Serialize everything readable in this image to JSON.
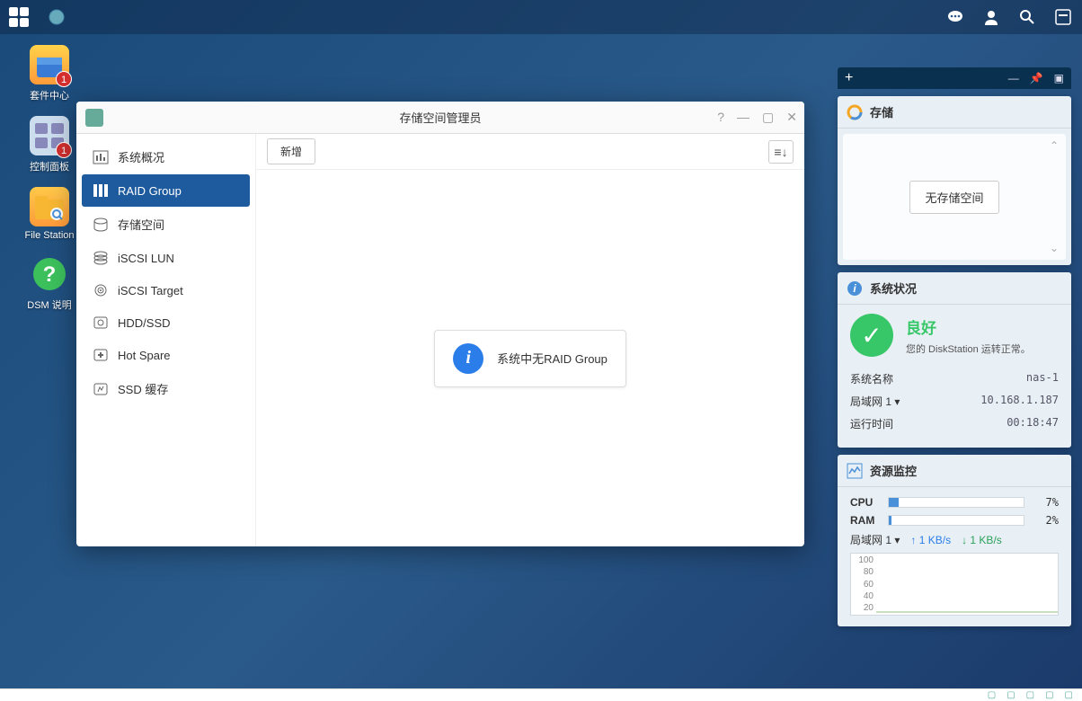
{
  "desktop": {
    "items": [
      {
        "label": "套件中心",
        "badge": "1"
      },
      {
        "label": "控制面板",
        "badge": "1"
      },
      {
        "label": "File Station"
      },
      {
        "label": "DSM 说明"
      }
    ]
  },
  "window": {
    "title": "存储空间管理员",
    "sidebar": [
      {
        "label": "系统概况"
      },
      {
        "label": "RAID Group"
      },
      {
        "label": "存储空间"
      },
      {
        "label": "iSCSI LUN"
      },
      {
        "label": "iSCSI Target"
      },
      {
        "label": "HDD/SSD"
      },
      {
        "label": "Hot Spare"
      },
      {
        "label": "SSD 缓存"
      }
    ],
    "toolbar": {
      "create": "新增"
    },
    "info_message": "系统中无RAID Group"
  },
  "widgets": {
    "storage": {
      "title": "存储",
      "button": "无存储空间"
    },
    "status": {
      "title": "系统状况",
      "health": "良好",
      "health_desc": "您的 DiskStation 运转正常。",
      "rows": [
        {
          "label": "系统名称",
          "value": "nas-1"
        },
        {
          "label": "局域网 1 ▾",
          "value": "10.168.1.187"
        },
        {
          "label": "运行时间",
          "value": "00:18:47"
        }
      ]
    },
    "monitor": {
      "title": "资源监控",
      "cpu": {
        "label": "CPU",
        "value": "7%",
        "pct": 7
      },
      "ram": {
        "label": "RAM",
        "value": "2%",
        "pct": 2
      },
      "net_label": "局域网 1 ▾",
      "up": "1 KB/s",
      "down": "1 KB/s",
      "ylabels": [
        "100",
        "80",
        "60",
        "40",
        "20"
      ]
    }
  },
  "chart_data": {
    "type": "line",
    "title": "Network throughput",
    "xlabel": "",
    "ylabel": "KB/s",
    "ylim": [
      0,
      100
    ],
    "series": [
      {
        "name": "up",
        "values": [
          1,
          1,
          1,
          1,
          1,
          1,
          1,
          1,
          1,
          1,
          1,
          1,
          1,
          1,
          1,
          1,
          1,
          1,
          1,
          1
        ],
        "color": "#2b7de9"
      },
      {
        "name": "down",
        "values": [
          1,
          1,
          1,
          1,
          1,
          1,
          1,
          1,
          1,
          1,
          1,
          1,
          1,
          1,
          1,
          1,
          1,
          3,
          2,
          1
        ],
        "color": "#2aa05a"
      }
    ]
  }
}
